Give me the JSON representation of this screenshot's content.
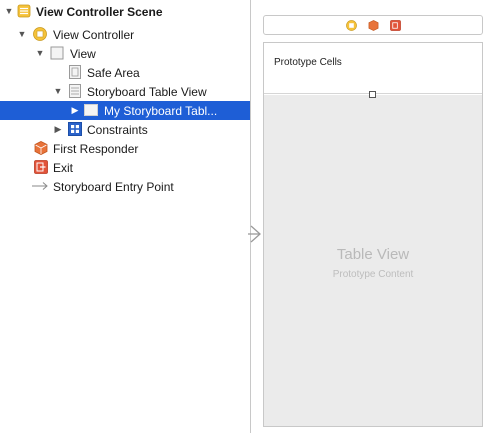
{
  "outline": {
    "scene_label": "View Controller Scene",
    "view_controller_label": "View Controller",
    "view_label": "View",
    "safe_area_label": "Safe Area",
    "table_view_label": "Storyboard Table View",
    "cell_label": "My Storyboard Tabl...",
    "constraints_label": "Constraints",
    "first_responder_label": "First Responder",
    "exit_label": "Exit",
    "entry_point_label": "Storyboard Entry Point"
  },
  "canvas": {
    "header_label": "Prototype Cells",
    "table_view_title": "Table View",
    "table_view_subtitle": "Prototype Content",
    "dock_icons": [
      "view-controller-icon",
      "first-responder-icon",
      "exit-icon"
    ]
  },
  "colors": {
    "selection": "#1e5ed6",
    "scene_icon": "#f5c23a",
    "first_responder": "#e8733a",
    "exit": "#e2533a",
    "constraints": "#2a62c9"
  }
}
